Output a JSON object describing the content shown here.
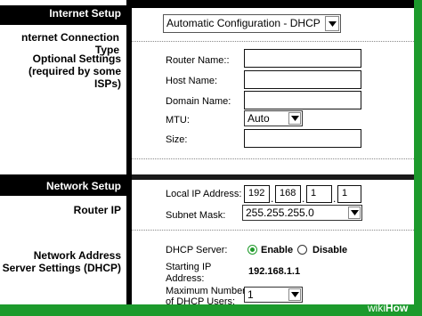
{
  "sections": {
    "internet_setup": "Internet Setup",
    "network_setup": "Network Setup"
  },
  "left": {
    "connection_type": "nternet Connection Type",
    "optional_line1": "Optional Settings",
    "optional_line2": "(required by some ISPs)",
    "router_ip": "Router IP",
    "nat_line1": "Network Address",
    "nat_line2": "Server Settings (DHCP)"
  },
  "connection": {
    "selected": "Automatic Configuration - DHCP"
  },
  "optional": {
    "router_name_label": "Router Name::",
    "host_name_label": "Host Name:",
    "domain_name_label": "Domain Name:",
    "mtu_label": "MTU:",
    "mtu_value": "Auto",
    "size_label": "Size:"
  },
  "router_ip": {
    "local_ip_label": "Local IP Address:",
    "octets": [
      "192",
      "168",
      "1",
      "1"
    ],
    "subnet_label": "Subnet Mask:",
    "subnet_value": "255.255.255.0"
  },
  "dhcp": {
    "server_label": "DHCP Server:",
    "enable_label": "Enable",
    "disable_label": "Disable",
    "enabled": true,
    "start_ip_label_1": "Starting IP",
    "start_ip_label_2": "Address:",
    "start_ip_value": "192.168.1.1",
    "max_users_label_1": "Maximum Number",
    "max_users_label_2": "of DHCP Users:",
    "max_users_value": "1"
  },
  "watermark": {
    "wiki": "wiki",
    "how": "How"
  },
  "colors": {
    "frame": "#1c9a2c",
    "bar": "#000000",
    "radio_on": "#1f9a2a"
  }
}
